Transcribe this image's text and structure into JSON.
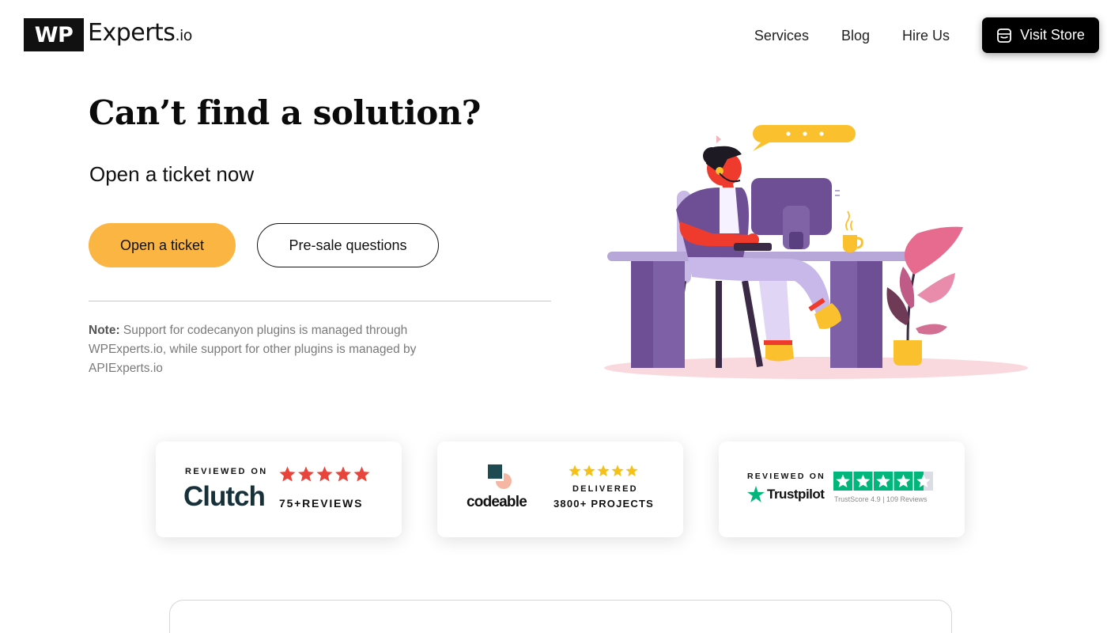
{
  "header": {
    "logo_box": "WP",
    "logo_text": "Experts",
    "logo_tld": ".io",
    "nav": [
      "Services",
      "Blog",
      "Hire Us"
    ],
    "visit_store": "Visit Store"
  },
  "hero": {
    "title": "Can’t find a solution?",
    "subtitle": "Open a ticket now",
    "primary_button": "Open a ticket",
    "secondary_button": "Pre-sale questions",
    "note_label": "Note:",
    "note_text": "Support for codecanyon plugins is managed through WPExperts.io, while support for other plugins is managed by APIExperts.io"
  },
  "reviews": {
    "clutch": {
      "reviewed_on": "REVIEWED ON",
      "brand": "Clutch",
      "rating": 5,
      "count": "75+REVIEWS",
      "star_color": "#e8443b"
    },
    "codeable": {
      "brand": "codeable",
      "rating": 5,
      "delivered": "DELIVERED",
      "projects": "3800+ PROJECTS",
      "star_color": "#f6c117"
    },
    "trustpilot": {
      "reviewed_on": "REVIEWED ON",
      "brand": "Trustpilot",
      "rating": 4.5,
      "score": "TrustScore 4.9 | 109 Reviews",
      "star_color": "#00b67a"
    }
  },
  "colors": {
    "accent": "#fbb543",
    "illustration_purple": "#6e4f95",
    "illustration_red": "#ef3b2d"
  }
}
